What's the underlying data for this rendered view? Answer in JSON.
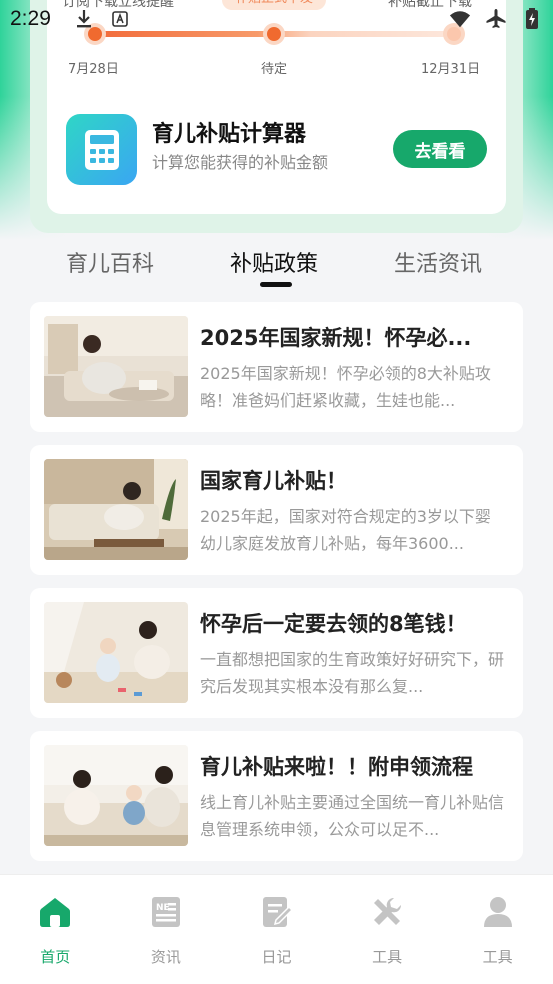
{
  "status_bar": {
    "time": "2:29"
  },
  "header_card": {
    "clipped_left_text": "订阅下载立线提醒",
    "clipped_badge": "补贴正式下发",
    "clipped_right_text": "补贴截止下载",
    "timeline": {
      "start_label": "7月28日",
      "mid_label": "待定",
      "end_label": "12月31日"
    },
    "calculator": {
      "title": "育儿补贴计算器",
      "subtitle": "计算您能获得的补贴金额",
      "button": "去看看"
    }
  },
  "tabs": [
    {
      "label": "育儿百科",
      "active": false
    },
    {
      "label": "补贴政策",
      "active": true
    },
    {
      "label": "生活资讯",
      "active": false
    }
  ],
  "articles": [
    {
      "title": "2025年国家新规！怀孕必...",
      "desc": "2025年国家新规！怀孕必领的8大补贴攻略！准爸妈们赶紧收藏，生娃也能..."
    },
    {
      "title": "国家育儿补贴！",
      "desc": "2025年起，国家对符合规定的3岁以下婴幼儿家庭发放育儿补贴，每年3600..."
    },
    {
      "title": "怀孕后一定要去领的8笔钱！",
      "desc": "一直都想把国家的生育政策好好研究下，研究后发现其实根本没有那么复..."
    },
    {
      "title": "育儿补贴来啦！！附申领流程",
      "desc": "线上育儿补贴主要通过全国统一育儿补贴信息管理系统申领，公众可以足不..."
    }
  ],
  "bottom_nav": [
    {
      "label": "首页",
      "icon": "home-icon",
      "active": true
    },
    {
      "label": "资讯",
      "icon": "news-icon",
      "active": false
    },
    {
      "label": "日记",
      "icon": "diary-icon",
      "active": false
    },
    {
      "label": "工具",
      "icon": "tools-icon",
      "active": false
    },
    {
      "label": "工具",
      "icon": "profile-icon",
      "active": false
    }
  ],
  "colors": {
    "accent_green": "#17a86b",
    "timeline_orange": "#f06a2f",
    "page_bg": "#f4f5f7"
  }
}
